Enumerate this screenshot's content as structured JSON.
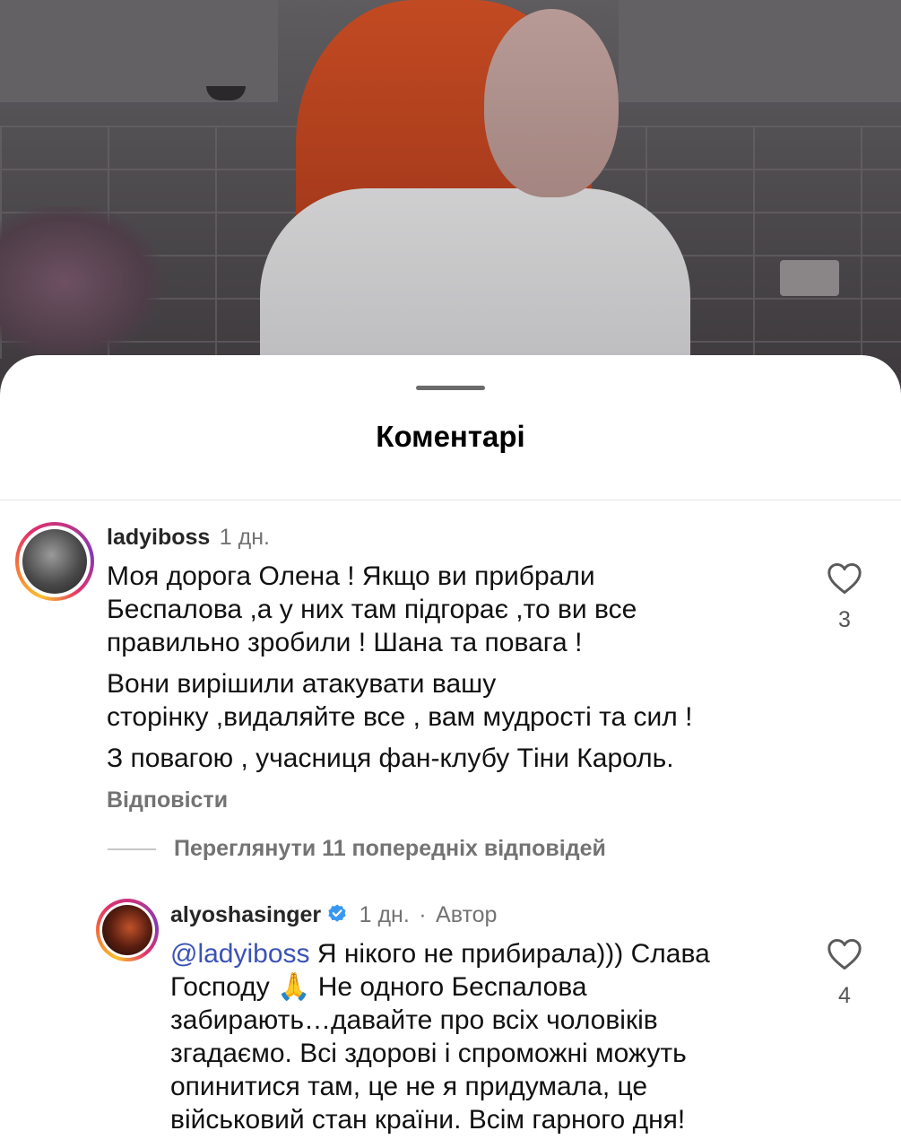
{
  "sheet": {
    "title": "Коментарі"
  },
  "comments": [
    {
      "username": "ladyiboss",
      "time": "1 дн.",
      "paragraphs": [
        [
          "Моя дорога Олена ! Якщо ви прибрали",
          "Беспалова ,а у них там підгорає ,то ви все",
          "правильно зробили ! Шана та повага !"
        ],
        [
          "Вони вирішили атакувати вашу",
          "сторінку ,видаляйте все , вам мудрості та сил !"
        ],
        [
          "З повагою , учасниця фан-клубу Тіни Кароль."
        ]
      ],
      "reply_label": "Відповісти",
      "likes": "3",
      "heart_icon": "heart-outline-icon"
    },
    {
      "username": "alyoshasinger",
      "verified": true,
      "time": "1 дн.",
      "separator": "·",
      "author_badge": "Автор",
      "mention": "@ladyiboss",
      "lines": [
        " Я нікого не прибирала))) Слава",
        "Господу 🙏 Не одного Беспалова",
        "забирають…давайте про всіх чоловіків",
        "згадаємо. Всі здорові і спроможні можуть",
        "опинитися там, це не я придумала, це",
        "військовий стан країни. Всім гарного дня!"
      ],
      "likes": "4",
      "heart_icon": "heart-outline-icon"
    }
  ],
  "view_replies": {
    "label": "Переглянути 11 попередніх відповідей"
  },
  "colors": {
    "mention": "#3b52b5",
    "verified": "#3897f0",
    "muted_text": "#737373"
  }
}
